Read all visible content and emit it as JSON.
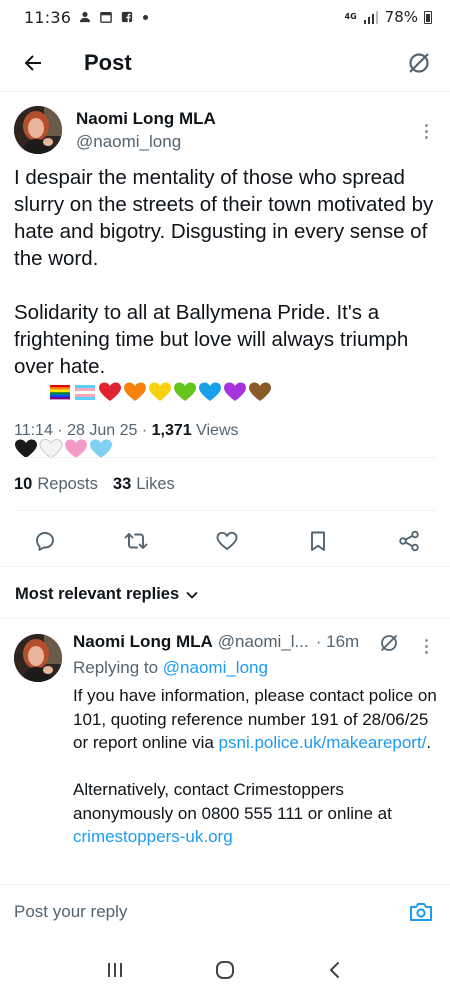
{
  "status_bar": {
    "time": "11:36",
    "network": "4G",
    "battery": "78%"
  },
  "header": {
    "title": "Post"
  },
  "post": {
    "author_name": "Naomi Long MLA",
    "author_handle": "@naomi_long",
    "paragraph1": "I despair the mentality of those who spread slurry on the streets of their town motivated by hate and bigotry. Disgusting in every sense of the word.",
    "paragraph2": "Solidarity to all at Ballymena Pride. It's a frightening time but love will always triumph over hate.",
    "emojis": [
      "rainbow-flag",
      "trans-flag",
      "red-heart",
      "orange-heart",
      "yellow-heart",
      "green-heart",
      "blue-heart",
      "purple-heart",
      "brown-heart",
      "black-heart",
      "white-heart",
      "pink-heart",
      "light-blue-heart"
    ],
    "time": "11:14",
    "date": "28 Jun 25",
    "views_count": "1,371",
    "views_label": "Views",
    "reposts_count": "10",
    "reposts_label": "Reposts",
    "likes_count": "33",
    "likes_label": "Likes"
  },
  "replies": {
    "header": "Most relevant replies",
    "items": [
      {
        "author_name": "Naomi Long MLA",
        "author_handle": "@naomi_l...",
        "time": "16m",
        "replying_prefix": "Replying to",
        "replying_handle": "@naomi_long",
        "text1_a": "If you have information, please contact police on 101, quoting reference number 191 of 28/06/25 or report online via ",
        "text1_link": "psni.police.uk/makeareport/",
        "text1_b": ".",
        "text2_a": "Alternatively, contact Crimestoppers anonymously on 0800 555 111 or online at ",
        "text2_link": "crimestoppers-uk.org"
      }
    ]
  },
  "composer": {
    "placeholder": "Post your reply"
  },
  "colors": {
    "text": "#0f1419",
    "secondary": "#536471",
    "link": "#1d9bf0",
    "divider": "#eff3f4"
  }
}
